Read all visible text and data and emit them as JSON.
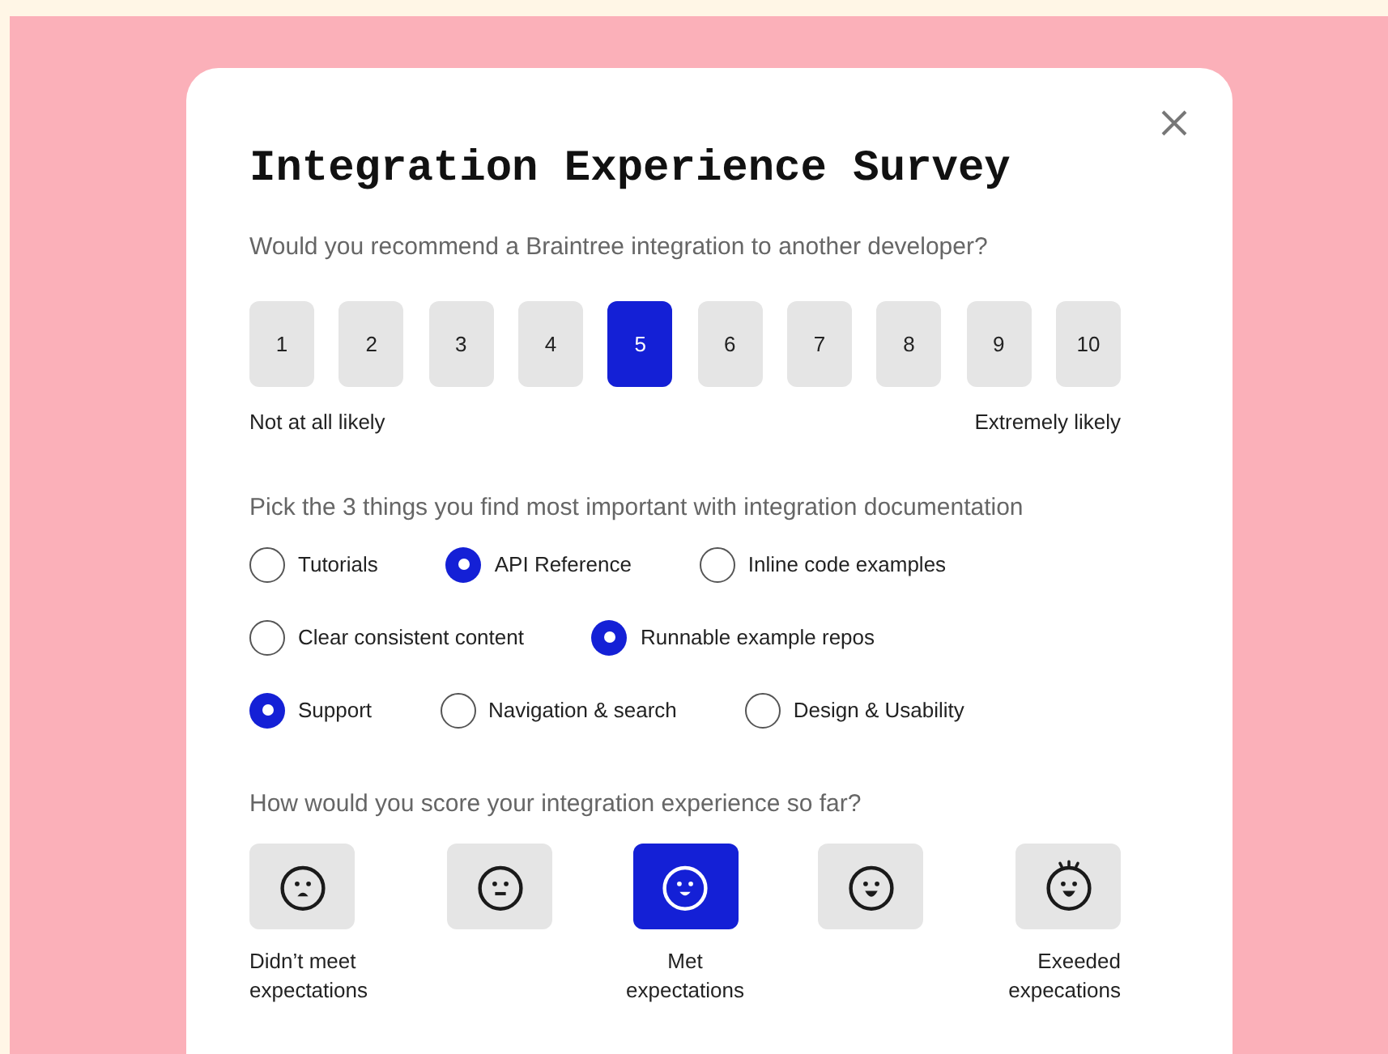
{
  "title": "Integration Experience Survey",
  "q1": {
    "question": "Would you recommend a Braintree integration to another developer?",
    "options": [
      {
        "label": "1",
        "selected": false
      },
      {
        "label": "2",
        "selected": false
      },
      {
        "label": "3",
        "selected": false
      },
      {
        "label": "4",
        "selected": false
      },
      {
        "label": "5",
        "selected": true
      },
      {
        "label": "6",
        "selected": false
      },
      {
        "label": "7",
        "selected": false
      },
      {
        "label": "8",
        "selected": false
      },
      {
        "label": "9",
        "selected": false
      },
      {
        "label": "10",
        "selected": false
      }
    ],
    "low_label": "Not at all likely",
    "high_label": "Extremely likely"
  },
  "q2": {
    "question": "Pick the 3 things you find most important with integration documentation",
    "rows": [
      [
        {
          "label": "Tutorials",
          "selected": false
        },
        {
          "label": "API Reference",
          "selected": true
        },
        {
          "label": "Inline code examples",
          "selected": false
        }
      ],
      [
        {
          "label": "Clear consistent content",
          "selected": false
        },
        {
          "label": "Runnable example repos",
          "selected": true
        }
      ],
      [
        {
          "label": "Support",
          "selected": true
        },
        {
          "label": "Navigation & search",
          "selected": false
        },
        {
          "label": "Design & Usability",
          "selected": false
        }
      ]
    ]
  },
  "q3": {
    "question": "How would you score your integration experience so far?",
    "options": [
      {
        "kind": "sad",
        "selected": false,
        "label": "Didn’t meet expectations"
      },
      {
        "kind": "neutral",
        "selected": false
      },
      {
        "kind": "smile",
        "selected": true,
        "label": "Met expectations"
      },
      {
        "kind": "grin",
        "selected": false
      },
      {
        "kind": "excited",
        "selected": false,
        "label": "Exeeded expecations"
      }
    ]
  }
}
